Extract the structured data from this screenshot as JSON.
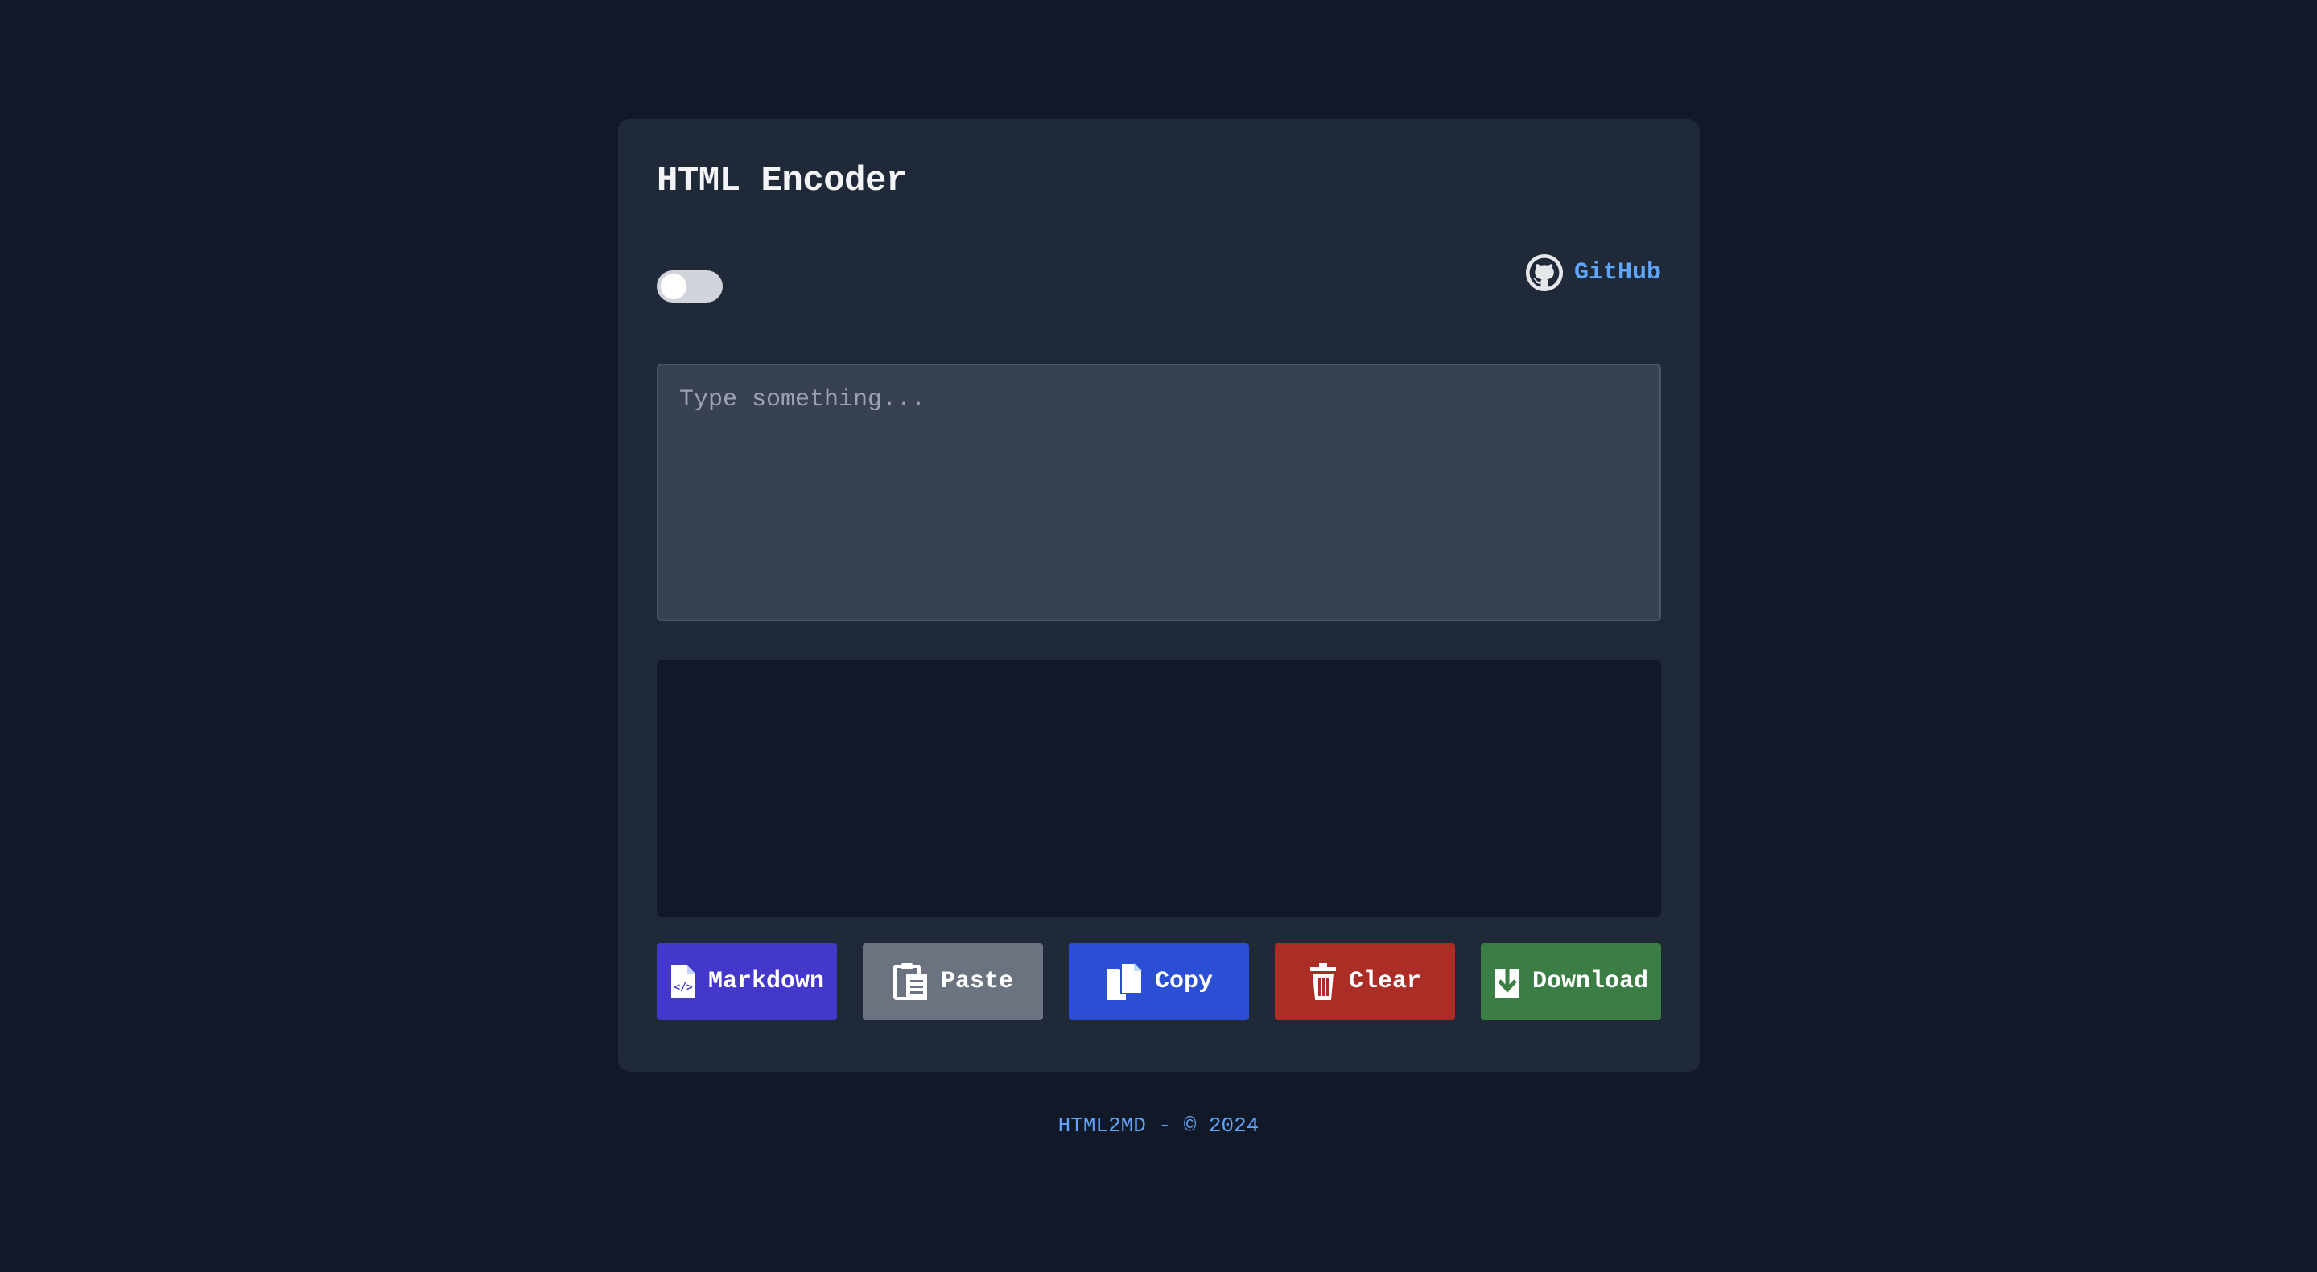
{
  "app": {
    "title": "HTML Encoder"
  },
  "header": {
    "github_label": "GitHub",
    "github_icon": "github-icon"
  },
  "theme_toggle": {
    "state": "off"
  },
  "input": {
    "value": "",
    "placeholder": "Type something..."
  },
  "output": {
    "value": ""
  },
  "buttons": [
    {
      "label": "Markdown",
      "icon": "file-code-icon",
      "color": "#4338ca"
    },
    {
      "label": "Paste",
      "icon": "clipboard-icon",
      "color": "#6b7280"
    },
    {
      "label": "Copy",
      "icon": "copy-icon",
      "color": "#2b4fd4"
    },
    {
      "label": "Clear",
      "icon": "trash-icon",
      "color": "#ac2d26"
    },
    {
      "label": "Download",
      "icon": "download-icon",
      "color": "#3a7e46"
    }
  ],
  "footer": {
    "text": "HTML2MD - © 2024"
  },
  "colors": {
    "background": "#111827",
    "card": "#1f2937",
    "accent": "#60a5fa"
  }
}
